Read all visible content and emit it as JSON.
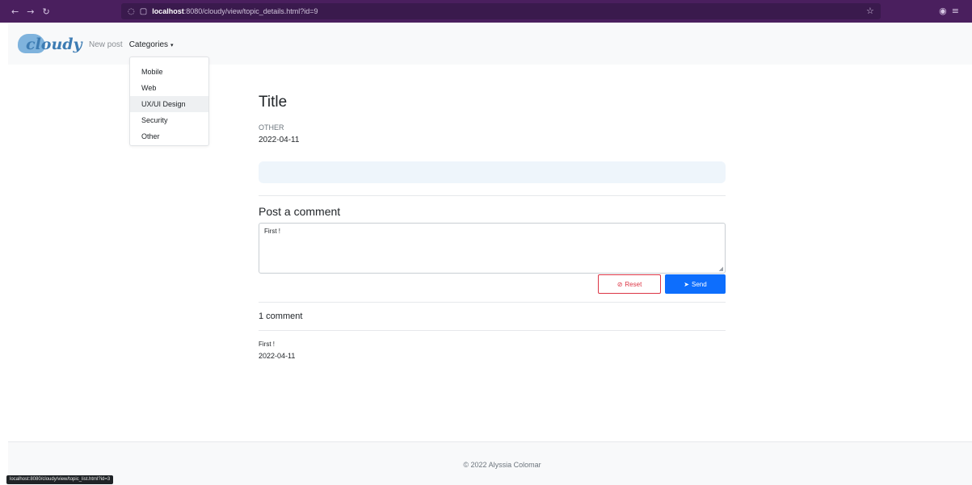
{
  "browser": {
    "nav_back": "←",
    "nav_forward": "→",
    "nav_reload": "↻",
    "url_host": "localhost",
    "url_path": ":8080/cloudy/view/topic_details.html?id=9",
    "icons": [
      "shield-icon",
      "page-icon",
      "star-icon",
      "extensions-icon"
    ],
    "status_url": "localhost:8080/cloudy/view/topic_list.html?id=3"
  },
  "navbar": {
    "logo_text": "cloudy",
    "new_post": "New post",
    "categories": "Categories",
    "caret": "▾"
  },
  "dropdown": {
    "items": [
      "Mobile",
      "Web",
      "UX/UI Design",
      "Security",
      "Other"
    ],
    "hovered": "UX/UI Design"
  },
  "topic": {
    "title": "Title",
    "category": "OTHER",
    "date": "2022-04-11"
  },
  "comment_form": {
    "heading": "Post a comment",
    "value": "First !",
    "reset_label": "Reset",
    "send_label": "Send"
  },
  "comments": {
    "count_label": "1 comment",
    "items": [
      {
        "text": "First !",
        "date": "2022-04-11"
      }
    ]
  },
  "footer": {
    "copyright": "© 2022 Alyssia Colomar"
  },
  "colors": {
    "browser_bar": "#4a1f5e",
    "primary": "#0d6efd",
    "danger": "#dc3545",
    "content_box": "#eef5fb"
  }
}
